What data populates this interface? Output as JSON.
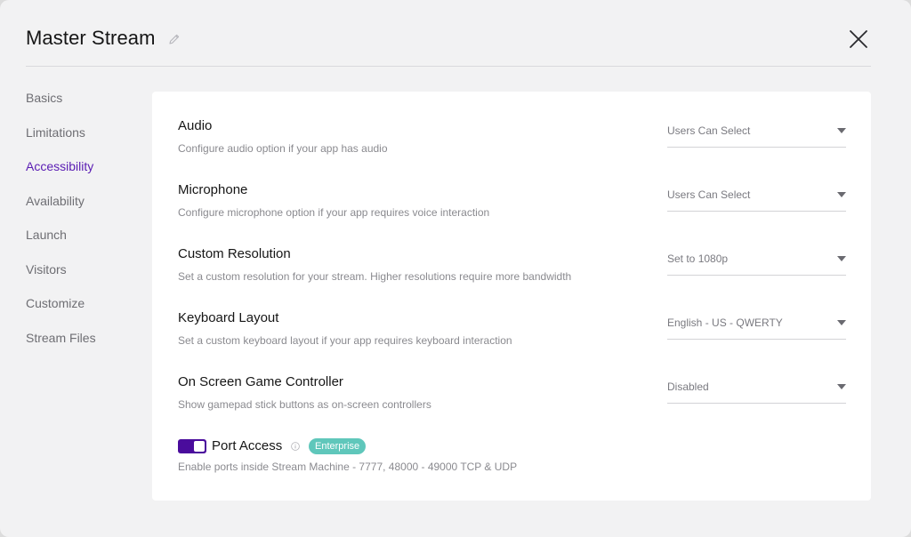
{
  "header": {
    "title": "Master Stream"
  },
  "sidebar": {
    "items": [
      {
        "label": "Basics"
      },
      {
        "label": "Limitations"
      },
      {
        "label": "Accessibility"
      },
      {
        "label": "Availability"
      },
      {
        "label": "Launch"
      },
      {
        "label": "Visitors"
      },
      {
        "label": "Customize"
      },
      {
        "label": "Stream Files"
      }
    ],
    "active_label": "Accessibility"
  },
  "settings": {
    "audio": {
      "title": "Audio",
      "description": "Configure audio option if your app has audio",
      "value": "Users Can Select"
    },
    "microphone": {
      "title": "Microphone",
      "description": "Configure microphone option if your app requires voice interaction",
      "value": "Users Can Select"
    },
    "resolution": {
      "title": "Custom Resolution",
      "description": "Set a custom resolution for your stream. Higher resolutions require more bandwidth",
      "value": "Set to 1080p"
    },
    "keyboard": {
      "title": "Keyboard Layout",
      "description": "Set a custom keyboard layout if your app requires keyboard interaction",
      "value": "English - US - QWERTY"
    },
    "controller": {
      "title": "On Screen Game Controller",
      "description": "Show gamepad stick buttons as on-screen controllers",
      "value": "Disabled"
    },
    "port_access": {
      "title": "Port Access",
      "badge": "Enterprise",
      "description": "Enable ports inside Stream Machine - 7777, 48000 - 49000 TCP & UDP",
      "enabled": true
    }
  },
  "colors": {
    "accent": "#4a0c9c",
    "active_nav": "#5a1cb3",
    "badge": "#5fc7bb"
  }
}
